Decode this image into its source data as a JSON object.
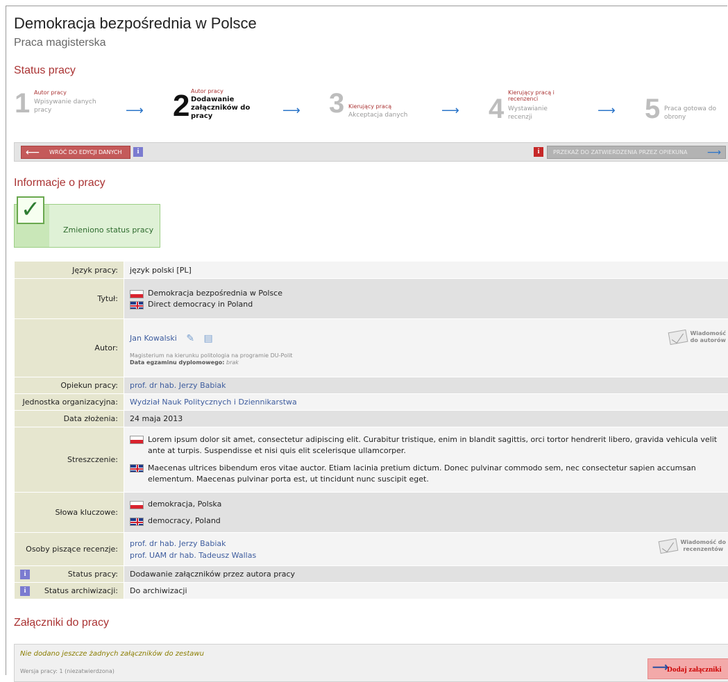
{
  "header": {
    "title": "Demokracja bezpośrednia w Polsce",
    "subtitle": "Praca magisterska"
  },
  "status_section": {
    "heading": "Status pracy",
    "steps": [
      {
        "number": "1",
        "actor": "Autor pracy",
        "desc": "Wpisywanie danych pracy"
      },
      {
        "number": "2",
        "actor": "Autor pracy",
        "desc": "Dodawanie załączników do pracy",
        "active": true
      },
      {
        "number": "3",
        "actor": "Kierujący pracą",
        "desc": "Akceptacja danych"
      },
      {
        "number": "4",
        "actor": "Kierujący pracą i recenzenci",
        "desc": "Wystawianie recenzji"
      },
      {
        "number": "5",
        "actor": "",
        "desc": "Praca gotowa do obrony"
      }
    ],
    "back_button": "WRÓĆ DO EDYCJI DANYCH",
    "forward_button": "PRZEKAŻ DO ZATWIERDZENIA PRZEZ OPIEKUNA",
    "info_glyph": "i"
  },
  "info_section": {
    "heading": "Informacje o pracy",
    "message": "Zmieniono status pracy"
  },
  "table": {
    "language_label": "Język pracy:",
    "language_value": "język polski [PL]",
    "title_label": "Tytuł:",
    "title_pl": "Demokracja bezpośrednia w Polsce",
    "title_en": "Direct democracy in Poland",
    "author_label": "Autor:",
    "author_name": "Jan Kowalski",
    "author_program": "Magisterium na kierunku politologia na programie DU-Polit",
    "exam_date_label": "Data egzaminu dyplomowego:",
    "exam_date_value": "brak",
    "author_message_line1": "Wiadomość",
    "author_message_line2": "do autorów",
    "supervisor_label": "Opiekun pracy:",
    "supervisor_value": "prof. dr hab. Jerzy Babiak",
    "unit_label": "Jednostka organizacyjna:",
    "unit_value": "Wydział Nauk Politycznych i Dziennikarstwa",
    "submitted_label": "Data złożenia:",
    "submitted_value": "24 maja 2013",
    "abstract_label": "Streszczenie:",
    "abstract_pl": "Lorem ipsum dolor sit amet, consectetur adipiscing elit. Curabitur tristique, enim in blandit sagittis, orci tortor hendrerit libero, gravida vehicula velit ante at turpis. Suspendisse et nisi quis elit scelerisque ullamcorper.",
    "abstract_en": "Maecenas ultrices bibendum eros vitae auctor. Etiam lacinia pretium dictum. Donec pulvinar commodo sem, nec consectetur sapien accumsan elementum. Maecenas pulvinar porta est, ut tincidunt nunc suscipit eget.",
    "keywords_label": "Słowa kluczowe:",
    "keywords_pl": "demokracja, Polska",
    "keywords_en": "democracy, Poland",
    "reviewers_label": "Osoby piszące recenzje:",
    "reviewer_1": "prof. dr hab. Jerzy Babiak",
    "reviewer_2": "prof. UAM dr hab. Tadeusz Wallas",
    "reviewer_message_line1": "Wiadomość do",
    "reviewer_message_line2": "recenzentów",
    "status_label": "Status pracy:",
    "status_value": "Dodawanie załączników przez autora pracy",
    "archive_label": "Status archiwizacji:",
    "archive_value": "Do archiwizacji"
  },
  "attachments": {
    "heading": "Załączniki do pracy",
    "empty_text": "Nie dodano jeszcze żadnych załączników do zestawu",
    "version_text": "Wersja pracy: 1 (niezatwierdzona)",
    "add_button": "Dodaj załączniki"
  }
}
